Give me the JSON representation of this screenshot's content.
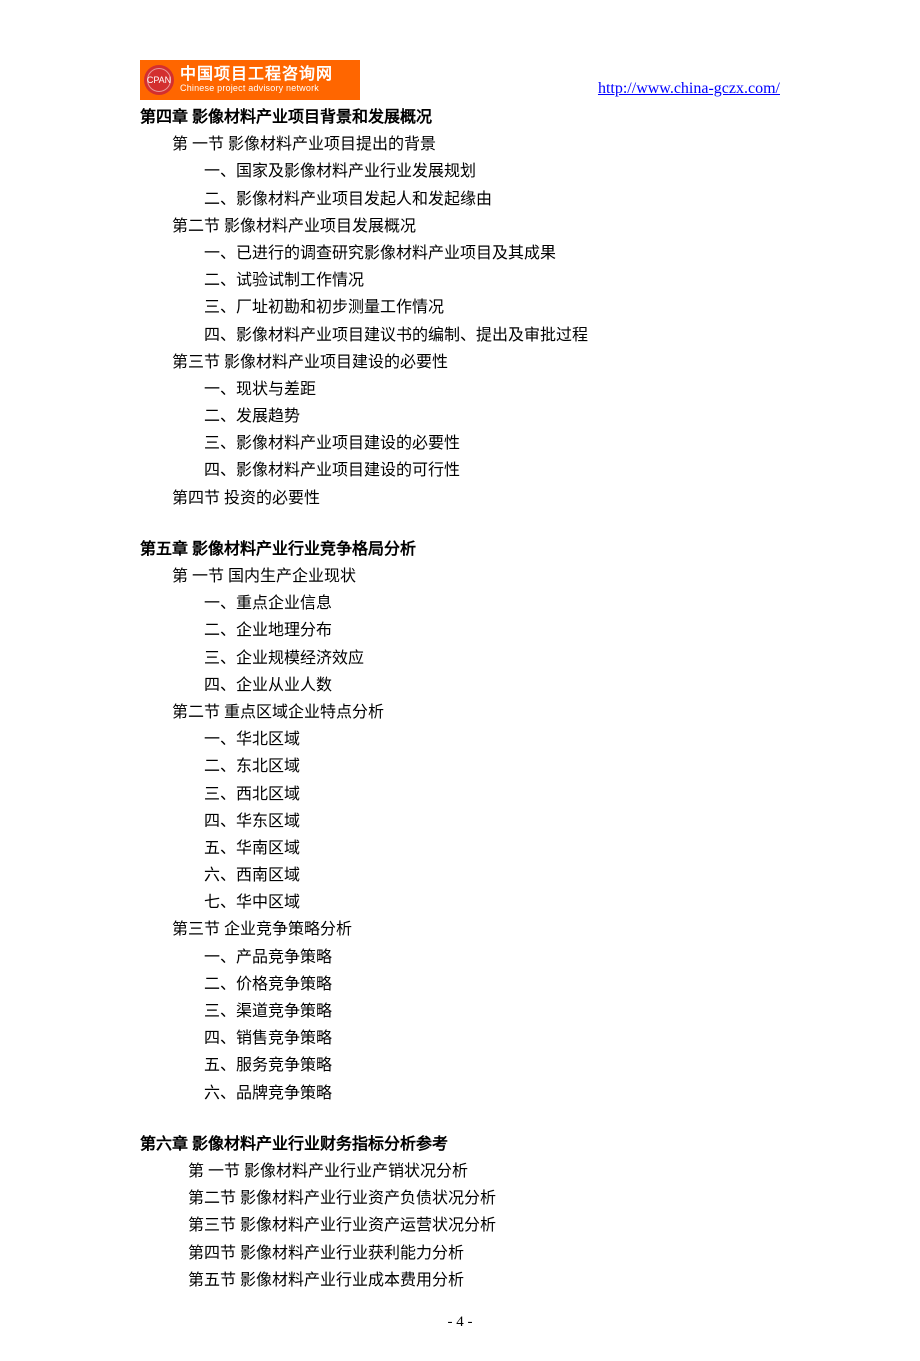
{
  "header": {
    "logo_cn": "中国项目工程咨询网",
    "logo_en": "Chinese project advisory network",
    "logo_badge": "CPAN",
    "url": "http://www.china-gczx.com/"
  },
  "chapters": {
    "c4": {
      "title": "第四章 影像材料产业项目背景和发展概况",
      "s1": {
        "title": "第 一节 影像材料产业项目提出的背景",
        "i1": "一、国家及影像材料产业行业发展规划",
        "i2": "二、影像材料产业项目发起人和发起缘由"
      },
      "s2": {
        "title": "第二节 影像材料产业项目发展概况",
        "i1": "一、已进行的调查研究影像材料产业项目及其成果",
        "i2": "二、试验试制工作情况",
        "i3": "三、厂址初勘和初步测量工作情况",
        "i4": "四、影像材料产业项目建议书的编制、提出及审批过程"
      },
      "s3": {
        "title": "第三节 影像材料产业项目建设的必要性",
        "i1": "一、现状与差距",
        "i2": "二、发展趋势",
        "i3": "三、影像材料产业项目建设的必要性",
        "i4": "四、影像材料产业项目建设的可行性"
      },
      "s4": {
        "title": "第四节  投资的必要性"
      }
    },
    "c5": {
      "title": "第五章 影像材料产业行业竞争格局分析",
      "s1": {
        "title": "第 一节  国内生产企业现状",
        "i1": "一、重点企业信息",
        "i2": "二、企业地理分布",
        "i3": "三、企业规模经济效应",
        "i4": "四、企业从业人数"
      },
      "s2": {
        "title": "第二节  重点区域企业特点分析",
        "i1": "一、华北区域",
        "i2": "二、东北区域",
        "i3": "三、西北区域",
        "i4": "四、华东区域",
        "i5": "五、华南区域",
        "i6": "六、西南区域",
        "i7": "七、华中区域"
      },
      "s3": {
        "title": "第三节  企业竞争策略分析",
        "i1": "一、产品竞争策略",
        "i2": "二、价格竞争策略",
        "i3": "三、渠道竞争策略",
        "i4": "四、销售竞争策略",
        "i5": "五、服务竞争策略",
        "i6": "六、品牌竞争策略"
      }
    },
    "c6": {
      "title": "第六章 影像材料产业行业财务指标分析参考",
      "s1": "第 一节 影像材料产业行业产销状况分析",
      "s2": "第二节 影像材料产业行业资产负债状况分析",
      "s3": "第三节 影像材料产业行业资产运营状况分析",
      "s4": "第四节 影像材料产业行业获利能力分析",
      "s5": "第五节 影像材料产业行业成本费用分析"
    }
  },
  "pagenum": "- 4 -"
}
